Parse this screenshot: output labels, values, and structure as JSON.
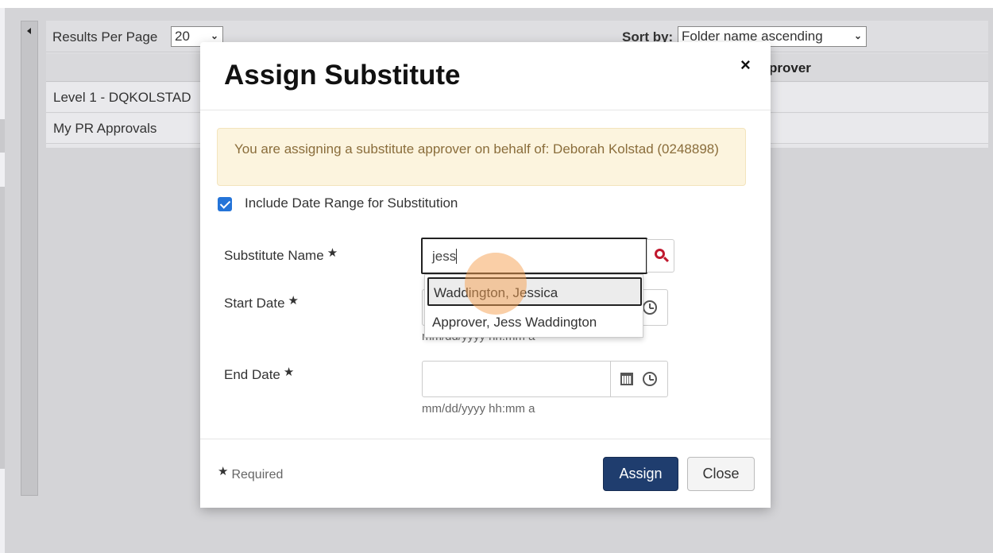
{
  "grid": {
    "results_per_page_label": "Results Per Page",
    "results_per_page_value": "20",
    "sort_label": "Sort by:",
    "sort_value": "Folder name ascending",
    "approver_column": "prover",
    "rows": [
      "Level 1 - DQKOLSTAD",
      "My PR Approvals"
    ]
  },
  "modal": {
    "title": "Assign Substitute",
    "close_symbol": "×",
    "alert_text": "You are assigning a substitute approver on behalf of: Deborah Kolstad (0248898)",
    "include_date_range_label": "Include Date Range for Substitution",
    "include_date_range_checked": true,
    "substitute_name_label": "Substitute Name",
    "substitute_name_value": "jess",
    "start_date_label": "Start Date",
    "end_date_label": "End Date",
    "date_format_hint": "mm/dd/yyyy hh:mm a",
    "required_star": "★",
    "suggestions": [
      "Waddington, Jessica",
      "Approver, Jess Waddington"
    ],
    "required_note": "Required",
    "assign_label": "Assign",
    "close_label": "Close"
  },
  "colors": {
    "assign_button": "#1f3d6e",
    "alert_background": "#fcf4de",
    "alert_text": "#8a6d3b",
    "checkbox": "#2474d8",
    "search_icon": "#c0182e"
  },
  "icons": [
    "collapse-arrow-icon",
    "chevron-down-icon",
    "close-icon",
    "checkbox-checked-icon",
    "search-icon",
    "calendar-icon",
    "clock-icon",
    "required-star-icon"
  ]
}
